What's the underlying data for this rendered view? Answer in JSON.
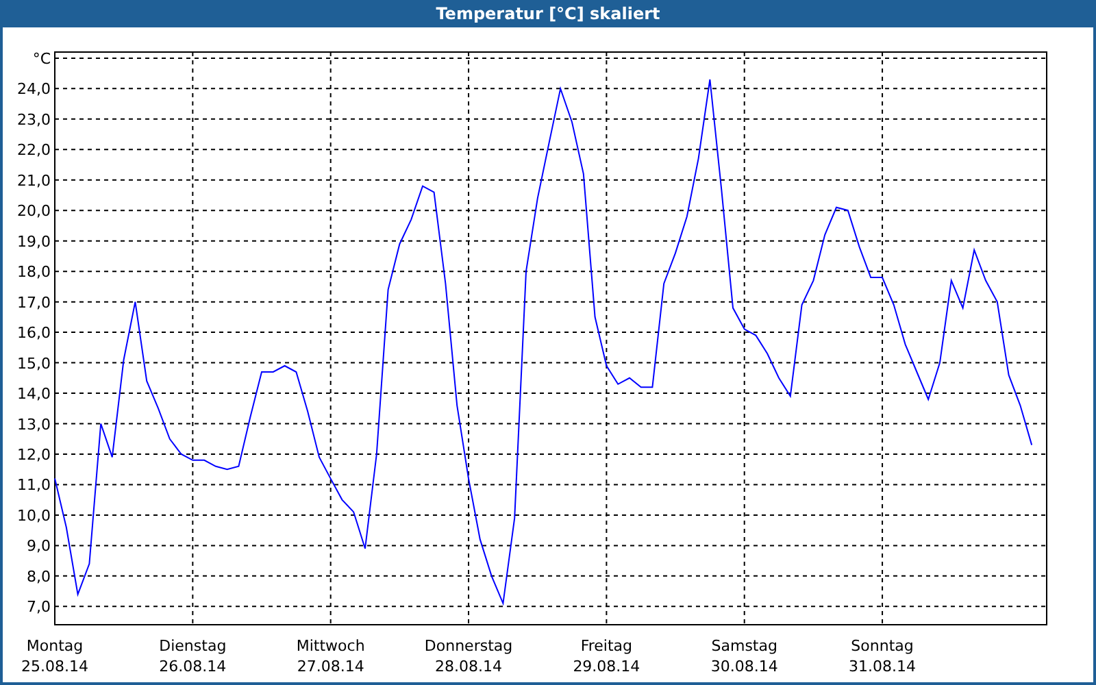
{
  "window": {
    "title": "Temperatur [°C] skaliert"
  },
  "chart": {
    "chart_data": {
      "type": "line",
      "grid": true,
      "ylim": [
        6.4,
        25.2
      ],
      "yticks": [
        {
          "value": 7,
          "label": "7,0"
        },
        {
          "value": 8,
          "label": "8,0"
        },
        {
          "value": 9,
          "label": "9,0"
        },
        {
          "value": 10,
          "label": "10,0"
        },
        {
          "value": 11,
          "label": "11,0"
        },
        {
          "value": 12,
          "label": "12,0"
        },
        {
          "value": 13,
          "label": "13,0"
        },
        {
          "value": 14,
          "label": "14,0"
        },
        {
          "value": 15,
          "label": "15,0"
        },
        {
          "value": 16,
          "label": "16,0"
        },
        {
          "value": 17,
          "label": "17,0"
        },
        {
          "value": 18,
          "label": "18,0"
        },
        {
          "value": 19,
          "label": "19,0"
        },
        {
          "value": 20,
          "label": "20,0"
        },
        {
          "value": 21,
          "label": "21,0"
        },
        {
          "value": 22,
          "label": "22,0"
        },
        {
          "value": 23,
          "label": "23,0"
        },
        {
          "value": 24,
          "label": "24,0"
        },
        {
          "value": 25,
          "label": "°C"
        }
      ],
      "categories": [
        "Montag\n25.08.14",
        null,
        null,
        null,
        null,
        null,
        null,
        null,
        null,
        null,
        null,
        null,
        "Dienstag\n26.08.14",
        null,
        null,
        null,
        null,
        null,
        null,
        null,
        null,
        null,
        null,
        null,
        "Mittwoch\n27.08.14",
        null,
        null,
        null,
        null,
        null,
        null,
        null,
        null,
        null,
        null,
        null,
        "Donnerstag\n28.08.14",
        null,
        null,
        null,
        null,
        null,
        null,
        null,
        null,
        null,
        null,
        null,
        "Freitag\n29.08.14",
        null,
        null,
        null,
        null,
        null,
        null,
        null,
        null,
        null,
        null,
        null,
        "Samstag\n30.08.14",
        null,
        null,
        null,
        null,
        null,
        null,
        null,
        null,
        null,
        null,
        null,
        "Sonntag\n31.08.14",
        null,
        null,
        null,
        null,
        null,
        null,
        null,
        null,
        null,
        null,
        null,
        null,
        null
      ],
      "series": [
        {
          "color": "#0000ff",
          "values": [
            11.2,
            9.6,
            7.4,
            8.4,
            13.0,
            11.9,
            15.1,
            17.0,
            14.4,
            13.5,
            12.5,
            12.0,
            11.8,
            11.8,
            11.6,
            11.5,
            11.6,
            13.2,
            14.7,
            14.7,
            14.9,
            14.7,
            13.4,
            11.9,
            11.2,
            10.5,
            10.1,
            8.9,
            12.0,
            17.4,
            18.9,
            19.7,
            20.8,
            20.6,
            17.6,
            13.6,
            11.2,
            9.2,
            8.0,
            7.1,
            9.9,
            18.0,
            20.4,
            22.2,
            24.0,
            22.9,
            21.2,
            16.5,
            14.9,
            14.3,
            14.5,
            14.2,
            14.2,
            17.6,
            18.6,
            19.8,
            21.7,
            24.3,
            20.7,
            16.8,
            16.1,
            15.9,
            15.3,
            14.5,
            13.9,
            16.9,
            17.7,
            19.2,
            20.1,
            20.0,
            18.8,
            17.8,
            17.8,
            16.9,
            15.6,
            14.7,
            13.8,
            15.0,
            17.7,
            16.8,
            18.7,
            17.7,
            17.0,
            14.6,
            13.6,
            12.3
          ]
        }
      ]
    }
  }
}
